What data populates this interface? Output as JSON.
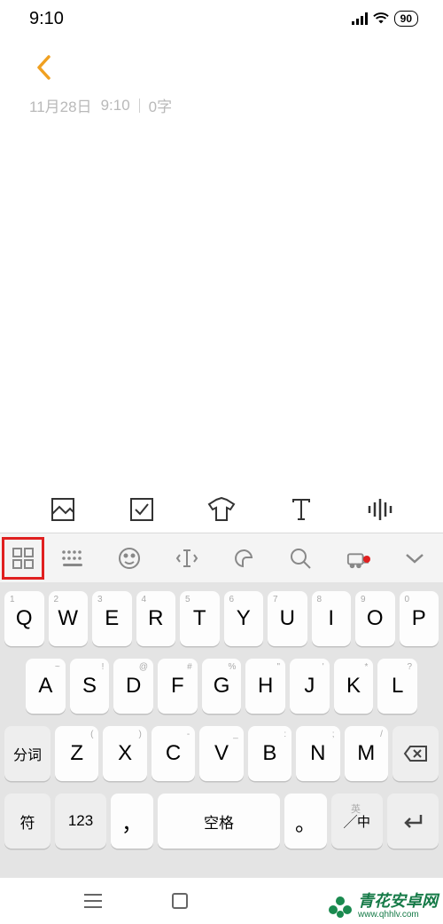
{
  "status": {
    "time": "9:10",
    "battery": "90"
  },
  "note": {
    "date": "11月28日",
    "time": "9:10",
    "count": "0字"
  },
  "keyboard": {
    "row1": [
      {
        "main": "Q",
        "hint": "1"
      },
      {
        "main": "W",
        "hint": "2"
      },
      {
        "main": "E",
        "hint": "3"
      },
      {
        "main": "R",
        "hint": "4"
      },
      {
        "main": "T",
        "hint": "5"
      },
      {
        "main": "Y",
        "hint": "6"
      },
      {
        "main": "U",
        "hint": "7"
      },
      {
        "main": "I",
        "hint": "8"
      },
      {
        "main": "O",
        "hint": "9"
      },
      {
        "main": "P",
        "hint": "0"
      }
    ],
    "row2": [
      {
        "main": "A",
        "hint": "~"
      },
      {
        "main": "S",
        "hint": "!"
      },
      {
        "main": "D",
        "hint": "@"
      },
      {
        "main": "F",
        "hint": "#"
      },
      {
        "main": "G",
        "hint": "%"
      },
      {
        "main": "H",
        "hint": "\""
      },
      {
        "main": "J",
        "hint": "'"
      },
      {
        "main": "K",
        "hint": "*"
      },
      {
        "main": "L",
        "hint": "?"
      }
    ],
    "row3": {
      "shift": "分词",
      "keys": [
        {
          "main": "Z",
          "hint": "("
        },
        {
          "main": "X",
          "hint": ")"
        },
        {
          "main": "C",
          "hint": "-"
        },
        {
          "main": "V",
          "hint": "_"
        },
        {
          "main": "B",
          "hint": ":"
        },
        {
          "main": "N",
          "hint": ";"
        },
        {
          "main": "M",
          "hint": "/"
        }
      ]
    },
    "row4": {
      "sym": "符",
      "num": "123",
      "comma": "，",
      "space": "空格",
      "period": "。",
      "lang_sub": "英",
      "lang_main": "中"
    }
  },
  "watermark": {
    "main": "青花安卓网",
    "sub": "www.qhhlv.com"
  }
}
